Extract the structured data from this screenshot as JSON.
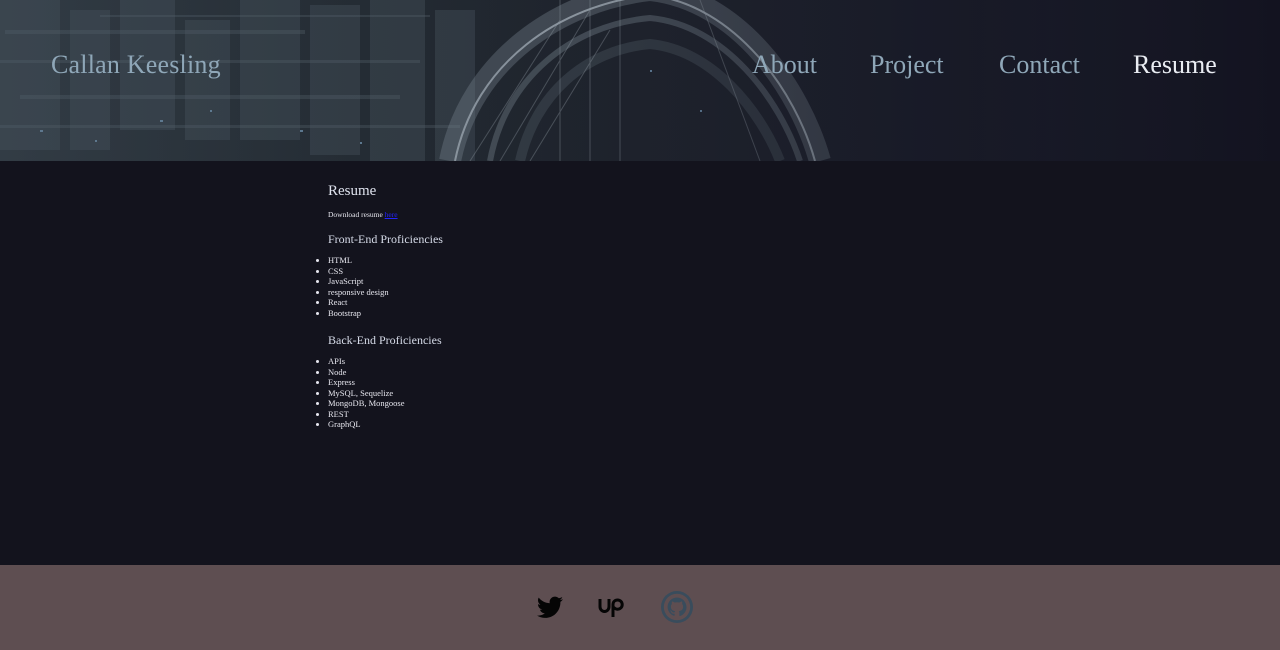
{
  "header": {
    "brand": "Callan Keesling",
    "nav": [
      {
        "label": "About"
      },
      {
        "label": "Project"
      },
      {
        "label": "Contact"
      },
      {
        "label": "Resume",
        "active": true
      }
    ]
  },
  "main": {
    "title": "Resume",
    "download_text": "Download resume ",
    "download_link": "here",
    "frontend": {
      "title": "Front-End Proficiencies",
      "items": [
        "HTML",
        "CSS",
        "JavaScript",
        "responsive design",
        "React",
        "Bootstrap"
      ]
    },
    "backend": {
      "title": "Back-End Proficiencies",
      "items": [
        "APIs",
        "Node",
        "Express",
        "MySQL, Sequelize",
        "MongoDB, Mongoose",
        "REST",
        "GraphQL"
      ]
    }
  },
  "footer": {
    "social": [
      {
        "icon": "twitter-icon"
      },
      {
        "icon": "upwork-icon"
      },
      {
        "icon": "github-icon"
      }
    ]
  },
  "colors": {
    "page_bg": "#13131d",
    "nav_text": "#8fa7b8",
    "nav_active": "#e9ecf2",
    "footer_bg": "#5e4e51",
    "link": "#2323ff"
  }
}
